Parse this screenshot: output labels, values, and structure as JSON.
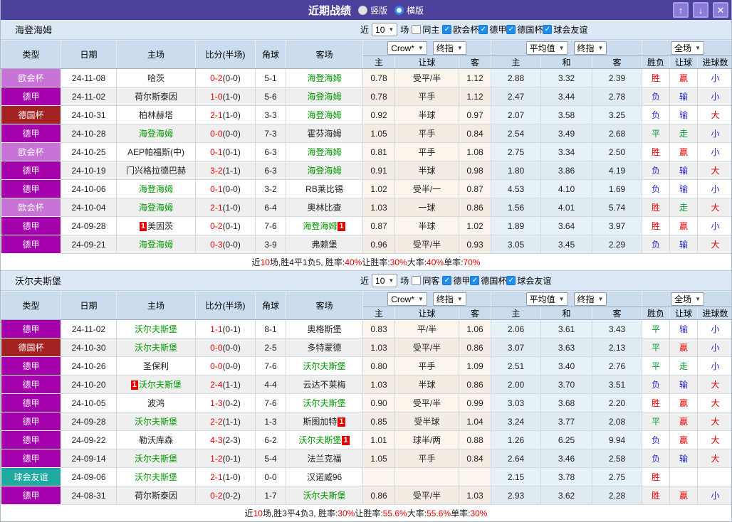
{
  "titlebar": {
    "title": "近期战绩",
    "radios": [
      {
        "label": "竖版",
        "selected": true
      },
      {
        "label": "横版",
        "selected": false
      }
    ],
    "window_buttons": {
      "up": "↑",
      "down": "↓",
      "close": "✕"
    }
  },
  "controls": {
    "near_label": "近",
    "games_value": "10",
    "games_suffix": "场",
    "bookmaker_select": "Crow*",
    "final_index_select": "终指",
    "average_select": "平均值",
    "final_index_select2": "终指",
    "full_match_select": "全场"
  },
  "columns": {
    "type": "类型",
    "date": "日期",
    "home": "主场",
    "score": "比分(半场)",
    "corner": "角球",
    "away": "客场",
    "odds_home": "主",
    "odds_handicap": "让球",
    "odds_away": "客",
    "avg_home": "主",
    "avg_draw": "和",
    "avg_away": "客",
    "result_wdl": "胜负",
    "result_handicap": "让球",
    "result_goals": "进球数"
  },
  "league_colors": {
    "欧会杯": "#C873D6",
    "德甲": "#A400AC",
    "德国杯": "#A52222",
    "球会友谊": "#1FA9A3"
  },
  "result_colors": {
    "r": "#E60000",
    "g": "#009933",
    "b": "#2A2AC8"
  },
  "tables": [
    {
      "team": "海登海姆",
      "same_checkbox": "同主",
      "league_filters": [
        "欧会杯",
        "德甲",
        "德国杯",
        "球会友谊"
      ],
      "rows": [
        {
          "lg": "欧会杯",
          "date": "24-11-08",
          "h": "哈茨",
          "a": "海登海姆",
          "aHl": true,
          "ft": "0-2",
          "ht": "(0-0)",
          "cr": "5-1",
          "o1": "0.78",
          "hc": "受平/半",
          "o2": "1.12",
          "a1": "2.88",
          "a2": "3.32",
          "a3": "2.39",
          "r1": "胜",
          "c1": "r",
          "r2": "赢",
          "c2": "r",
          "r3": "小",
          "c3": "b"
        },
        {
          "lg": "德甲",
          "date": "24-11-02",
          "h": "荷尔斯泰因",
          "a": "海登海姆",
          "aHl": true,
          "ft": "1-0",
          "ht": "(1-0)",
          "cr": "5-6",
          "o1": "0.78",
          "hc": "平手",
          "o2": "1.12",
          "a1": "2.47",
          "a2": "3.44",
          "a3": "2.78",
          "r1": "负",
          "c1": "b",
          "r2": "输",
          "c2": "b",
          "r3": "小",
          "c3": "b"
        },
        {
          "lg": "德国杯",
          "date": "24-10-31",
          "h": "柏林赫塔",
          "a": "海登海姆",
          "aHl": true,
          "ft": "2-1",
          "ht": "(1-0)",
          "cr": "3-3",
          "o1": "0.92",
          "hc": "半球",
          "o2": "0.97",
          "a1": "2.07",
          "a2": "3.58",
          "a3": "3.25",
          "r1": "负",
          "c1": "b",
          "r2": "输",
          "c2": "b",
          "r3": "大",
          "c3": "r"
        },
        {
          "lg": "德甲",
          "date": "24-10-28",
          "h": "海登海姆",
          "hHl": true,
          "a": "霍芬海姆",
          "ft": "0-0",
          "ht": "(0-0)",
          "cr": "7-3",
          "o1": "1.05",
          "hc": "平手",
          "o2": "0.84",
          "a1": "2.54",
          "a2": "3.49",
          "a3": "2.68",
          "r1": "平",
          "c1": "g",
          "r2": "走",
          "c2": "g",
          "r3": "小",
          "c3": "b"
        },
        {
          "lg": "欧会杯",
          "date": "24-10-25",
          "h": "AEP帕福斯(中)",
          "a": "海登海姆",
          "aHl": true,
          "ft": "0-1",
          "ht": "(0-1)",
          "cr": "6-3",
          "o1": "0.81",
          "hc": "平手",
          "o2": "1.08",
          "a1": "2.75",
          "a2": "3.34",
          "a3": "2.50",
          "r1": "胜",
          "c1": "r",
          "r2": "赢",
          "c2": "r",
          "r3": "小",
          "c3": "b"
        },
        {
          "lg": "德甲",
          "date": "24-10-19",
          "h": "门兴格拉德巴赫",
          "a": "海登海姆",
          "aHl": true,
          "ft": "3-2",
          "ht": "(1-1)",
          "cr": "6-3",
          "o1": "0.91",
          "hc": "半球",
          "o2": "0.98",
          "a1": "1.80",
          "a2": "3.86",
          "a3": "4.19",
          "r1": "负",
          "c1": "b",
          "r2": "输",
          "c2": "b",
          "r3": "大",
          "c3": "r"
        },
        {
          "lg": "德甲",
          "date": "24-10-06",
          "h": "海登海姆",
          "hHl": true,
          "a": "RB莱比锡",
          "ft": "0-1",
          "ht": "(0-0)",
          "cr": "3-2",
          "o1": "1.02",
          "hc": "受半/一",
          "o2": "0.87",
          "a1": "4.53",
          "a2": "4.10",
          "a3": "1.69",
          "r1": "负",
          "c1": "b",
          "r2": "输",
          "c2": "b",
          "r3": "小",
          "c3": "b"
        },
        {
          "lg": "欧会杯",
          "date": "24-10-04",
          "h": "海登海姆",
          "hHl": true,
          "a": "奥林比查",
          "ft": "2-1",
          "ht": "(1-0)",
          "cr": "6-4",
          "o1": "1.03",
          "hc": "一球",
          "o2": "0.86",
          "a1": "1.56",
          "a2": "4.01",
          "a3": "5.74",
          "r1": "胜",
          "c1": "r",
          "r2": "走",
          "c2": "g",
          "r3": "大",
          "c3": "r"
        },
        {
          "lg": "德甲",
          "date": "24-09-28",
          "h": "美因茨",
          "hPre": "1",
          "a": "海登海姆",
          "aHl": true,
          "aPost": "1",
          "ft": "0-2",
          "ht": "(0-1)",
          "cr": "7-6",
          "o1": "0.87",
          "hc": "半球",
          "o2": "1.02",
          "a1": "1.89",
          "a2": "3.64",
          "a3": "3.97",
          "r1": "胜",
          "c1": "r",
          "r2": "赢",
          "c2": "r",
          "r3": "小",
          "c3": "b"
        },
        {
          "lg": "德甲",
          "date": "24-09-21",
          "h": "海登海姆",
          "hHl": true,
          "a": "弗赖堡",
          "ft": "0-3",
          "ht": "(0-0)",
          "cr": "3-9",
          "o1": "0.96",
          "hc": "受平/半",
          "o2": "0.93",
          "a1": "3.05",
          "a2": "3.45",
          "a3": "2.29",
          "r1": "负",
          "c1": "b",
          "r2": "输",
          "c2": "b",
          "r3": "大",
          "c3": "r"
        }
      ],
      "summary": [
        {
          "t": "近",
          "c": "k"
        },
        {
          "t": "10",
          "c": "r"
        },
        {
          "t": "场,胜4平1负5, 胜率:",
          "c": "k"
        },
        {
          "t": "40%",
          "c": "r"
        },
        {
          "t": " 让胜率:",
          "c": "k"
        },
        {
          "t": "30%",
          "c": "r"
        },
        {
          "t": " 大率:",
          "c": "k"
        },
        {
          "t": "40%",
          "c": "r"
        },
        {
          "t": " 单率:",
          "c": "k"
        },
        {
          "t": "70%",
          "c": "r"
        }
      ]
    },
    {
      "team": "沃尔夫斯堡",
      "same_checkbox": "同客",
      "league_filters": [
        "德甲",
        "德国杯",
        "球会友谊"
      ],
      "rows": [
        {
          "lg": "德甲",
          "date": "24-11-02",
          "h": "沃尔夫斯堡",
          "hHl": true,
          "a": "奥格斯堡",
          "ft": "1-1",
          "ht": "(0-1)",
          "cr": "8-1",
          "o1": "0.83",
          "hc": "平/半",
          "o2": "1.06",
          "a1": "2.06",
          "a2": "3.61",
          "a3": "3.43",
          "r1": "平",
          "c1": "g",
          "r2": "输",
          "c2": "b",
          "r3": "小",
          "c3": "b"
        },
        {
          "lg": "德国杯",
          "date": "24-10-30",
          "h": "沃尔夫斯堡",
          "hHl": true,
          "a": "多特蒙德",
          "ft": "0-0",
          "ht": "(0-0)",
          "cr": "2-5",
          "o1": "1.03",
          "hc": "受平/半",
          "o2": "0.86",
          "a1": "3.07",
          "a2": "3.63",
          "a3": "2.13",
          "r1": "平",
          "c1": "g",
          "r2": "赢",
          "c2": "r",
          "r3": "小",
          "c3": "b"
        },
        {
          "lg": "德甲",
          "date": "24-10-26",
          "h": "圣保利",
          "a": "沃尔夫斯堡",
          "aHl": true,
          "ft": "0-0",
          "ht": "(0-0)",
          "cr": "7-6",
          "o1": "0.80",
          "hc": "平手",
          "o2": "1.09",
          "a1": "2.51",
          "a2": "3.40",
          "a3": "2.76",
          "r1": "平",
          "c1": "g",
          "r2": "走",
          "c2": "g",
          "r3": "小",
          "c3": "b"
        },
        {
          "lg": "德甲",
          "date": "24-10-20",
          "h": "沃尔夫斯堡",
          "hHl": true,
          "hPre": "1",
          "a": "云达不莱梅",
          "ft": "2-4",
          "ht": "(1-1)",
          "cr": "4-4",
          "o1": "1.03",
          "hc": "半球",
          "o2": "0.86",
          "a1": "2.00",
          "a2": "3.70",
          "a3": "3.51",
          "r1": "负",
          "c1": "b",
          "r2": "输",
          "c2": "b",
          "r3": "大",
          "c3": "r"
        },
        {
          "lg": "德甲",
          "date": "24-10-05",
          "h": "波鸿",
          "a": "沃尔夫斯堡",
          "aHl": true,
          "ft": "1-3",
          "ht": "(0-2)",
          "cr": "7-6",
          "o1": "0.90",
          "hc": "受平/半",
          "o2": "0.99",
          "a1": "3.03",
          "a2": "3.68",
          "a3": "2.20",
          "r1": "胜",
          "c1": "r",
          "r2": "赢",
          "c2": "r",
          "r3": "大",
          "c3": "r"
        },
        {
          "lg": "德甲",
          "date": "24-09-28",
          "h": "沃尔夫斯堡",
          "hHl": true,
          "a": "斯图加特",
          "aPost": "1",
          "ft": "2-2",
          "ht": "(1-1)",
          "cr": "1-3",
          "o1": "0.85",
          "hc": "受半球",
          "o2": "1.04",
          "a1": "3.24",
          "a2": "3.77",
          "a3": "2.08",
          "r1": "平",
          "c1": "g",
          "r2": "赢",
          "c2": "r",
          "r3": "大",
          "c3": "r"
        },
        {
          "lg": "德甲",
          "date": "24-09-22",
          "h": "勒沃库森",
          "a": "沃尔夫斯堡",
          "aHl": true,
          "aPost": "1",
          "ft": "4-3",
          "ht": "(2-3)",
          "cr": "6-2",
          "o1": "1.01",
          "hc": "球半/两",
          "o2": "0.88",
          "a1": "1.26",
          "a2": "6.25",
          "a3": "9.94",
          "r1": "负",
          "c1": "b",
          "r2": "赢",
          "c2": "r",
          "r3": "大",
          "c3": "r"
        },
        {
          "lg": "德甲",
          "date": "24-09-14",
          "h": "沃尔夫斯堡",
          "hHl": true,
          "a": "法兰克福",
          "ft": "1-2",
          "ht": "(0-1)",
          "cr": "5-4",
          "o1": "1.05",
          "hc": "平手",
          "o2": "0.84",
          "a1": "2.64",
          "a2": "3.46",
          "a3": "2.58",
          "r1": "负",
          "c1": "b",
          "r2": "输",
          "c2": "b",
          "r3": "大",
          "c3": "r"
        },
        {
          "lg": "球会友谊",
          "date": "24-09-06",
          "h": "沃尔夫斯堡",
          "hHl": true,
          "a": "汉诺威96",
          "ft": "2-1",
          "ht": "(1-0)",
          "cr": "0-0",
          "o1": "",
          "hc": "",
          "o2": "",
          "a1": "2.15",
          "a2": "3.78",
          "a3": "2.75",
          "r1": "胜",
          "c1": "r",
          "r2": "",
          "c2": "k",
          "r3": "",
          "c3": "k"
        },
        {
          "lg": "德甲",
          "date": "24-08-31",
          "h": "荷尔斯泰因",
          "a": "沃尔夫斯堡",
          "aHl": true,
          "ft": "0-2",
          "ht": "(0-2)",
          "cr": "1-7",
          "o1": "0.86",
          "hc": "受平/半",
          "o2": "1.03",
          "a1": "2.93",
          "a2": "3.62",
          "a3": "2.28",
          "r1": "胜",
          "c1": "r",
          "r2": "赢",
          "c2": "r",
          "r3": "小",
          "c3": "b"
        }
      ],
      "summary": [
        {
          "t": "近",
          "c": "k"
        },
        {
          "t": "10",
          "c": "r"
        },
        {
          "t": "场,胜3平4负3, 胜率:",
          "c": "k"
        },
        {
          "t": "30%",
          "c": "r"
        },
        {
          "t": " 让胜率:",
          "c": "k"
        },
        {
          "t": "55.6%",
          "c": "r"
        },
        {
          "t": " 大率:",
          "c": "k"
        },
        {
          "t": "55.6%",
          "c": "r"
        },
        {
          "t": " 单率:",
          "c": "k"
        },
        {
          "t": "30%",
          "c": "r"
        }
      ]
    }
  ]
}
